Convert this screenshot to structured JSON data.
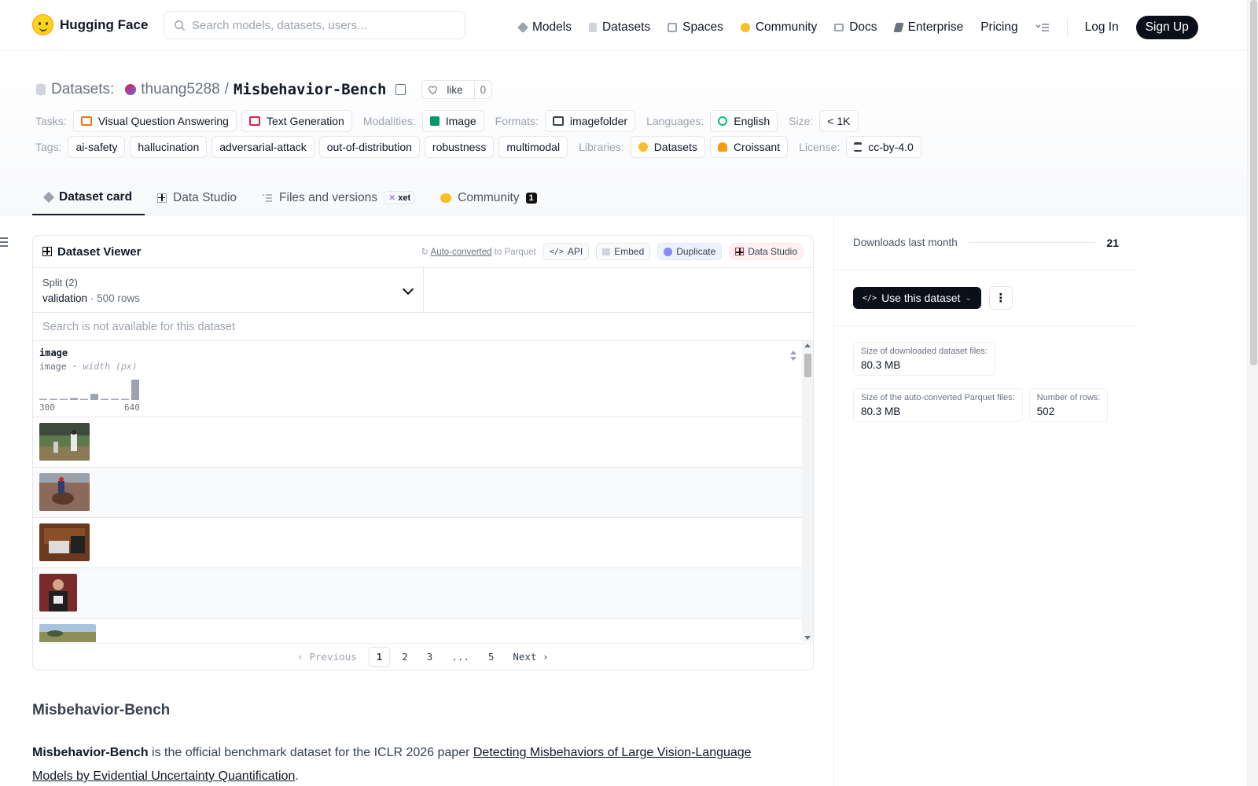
{
  "header": {
    "brand": "Hugging Face",
    "search_placeholder": "Search models, datasets, users...",
    "nav": [
      {
        "label": "Models",
        "icon": "cube-icon",
        "color": "#6b7280"
      },
      {
        "label": "Datasets",
        "icon": "database-icon",
        "color": "#9ca3af"
      },
      {
        "label": "Spaces",
        "icon": "grid-icon",
        "color": "#9ca3af"
      },
      {
        "label": "Community",
        "icon": "hands-icon",
        "color": "#f5b400"
      },
      {
        "label": "Docs",
        "icon": "book-icon",
        "color": "#9ca3af"
      },
      {
        "label": "Enterprise",
        "icon": "enterprise-icon",
        "color": "#6b7280"
      },
      {
        "label": "Pricing"
      }
    ],
    "login": "Log In",
    "signup": "Sign Up"
  },
  "dataset": {
    "section": "Datasets:",
    "owner": "thuang5288",
    "slash": "/",
    "name": "Misbehavior-Bench",
    "like_label": "like",
    "like_count": "0"
  },
  "meta": {
    "tasks_label": "Tasks:",
    "tasks": [
      "Visual Question Answering",
      "Text Generation"
    ],
    "modalities_label": "Modalities:",
    "modalities": [
      "Image"
    ],
    "formats_label": "Formats:",
    "formats": [
      "imagefolder"
    ],
    "languages_label": "Languages:",
    "languages": [
      "English"
    ],
    "size_label": "Size:",
    "size": "< 1K",
    "tags_label": "Tags:",
    "tags": [
      "ai-safety",
      "hallucination",
      "adversarial-attack",
      "out-of-distribution",
      "robustness",
      "multimodal"
    ],
    "libraries_label": "Libraries:",
    "libraries": [
      "Datasets",
      "Croissant"
    ],
    "license_label": "License:",
    "license": "cc-by-4.0"
  },
  "tabs": {
    "card": "Dataset card",
    "studio": "Data Studio",
    "files": "Files and versions",
    "xet": "xet",
    "community": "Community",
    "community_count": "1"
  },
  "viewer": {
    "title": "Dataset Viewer",
    "auto_converted": "Auto-converted",
    "to_parquet": "to Parquet",
    "api": "API",
    "embed": "Embed",
    "duplicate": "Duplicate",
    "data_studio": "Data Studio",
    "split_label": "Split (2)",
    "split_value": "validation",
    "split_rows": "500 rows",
    "search_placeholder": "Search is not available for this dataset",
    "column_name": "image",
    "column_type": "image",
    "column_stat": "width (px)",
    "hist_min": "300",
    "hist_max": "640",
    "hist_values": [
      0.05,
      0.05,
      0.05,
      0.1,
      0.05,
      0.3,
      0.05,
      0.05,
      0.05,
      1.0
    ],
    "pager": {
      "previous": "Previous",
      "pages": [
        "1",
        "2",
        "3",
        "...",
        "5"
      ],
      "next": "Next"
    }
  },
  "readme": {
    "heading": "Misbehavior-Bench",
    "bold": "Misbehavior-Bench",
    "text": " is the official benchmark dataset for the ICLR 2026 paper ",
    "link": "Detecting Misbehaviors of Large Vision-Language Models by Evidential Uncertainty Quantification",
    "end": "."
  },
  "sidebar": {
    "downloads_label": "Downloads last month",
    "downloads": "21",
    "use_button": "Use this dataset",
    "stats": {
      "download_size_label": "Size of downloaded dataset files:",
      "download_size": "80.3 MB",
      "parquet_size_label": "Size of the auto-converted Parquet files:",
      "parquet_size": "80.3 MB",
      "rows_label": "Number of rows:",
      "rows": "502"
    }
  },
  "colors": {
    "accent_dark": "#0b0f19",
    "hist_bar": "#9ca3af"
  }
}
